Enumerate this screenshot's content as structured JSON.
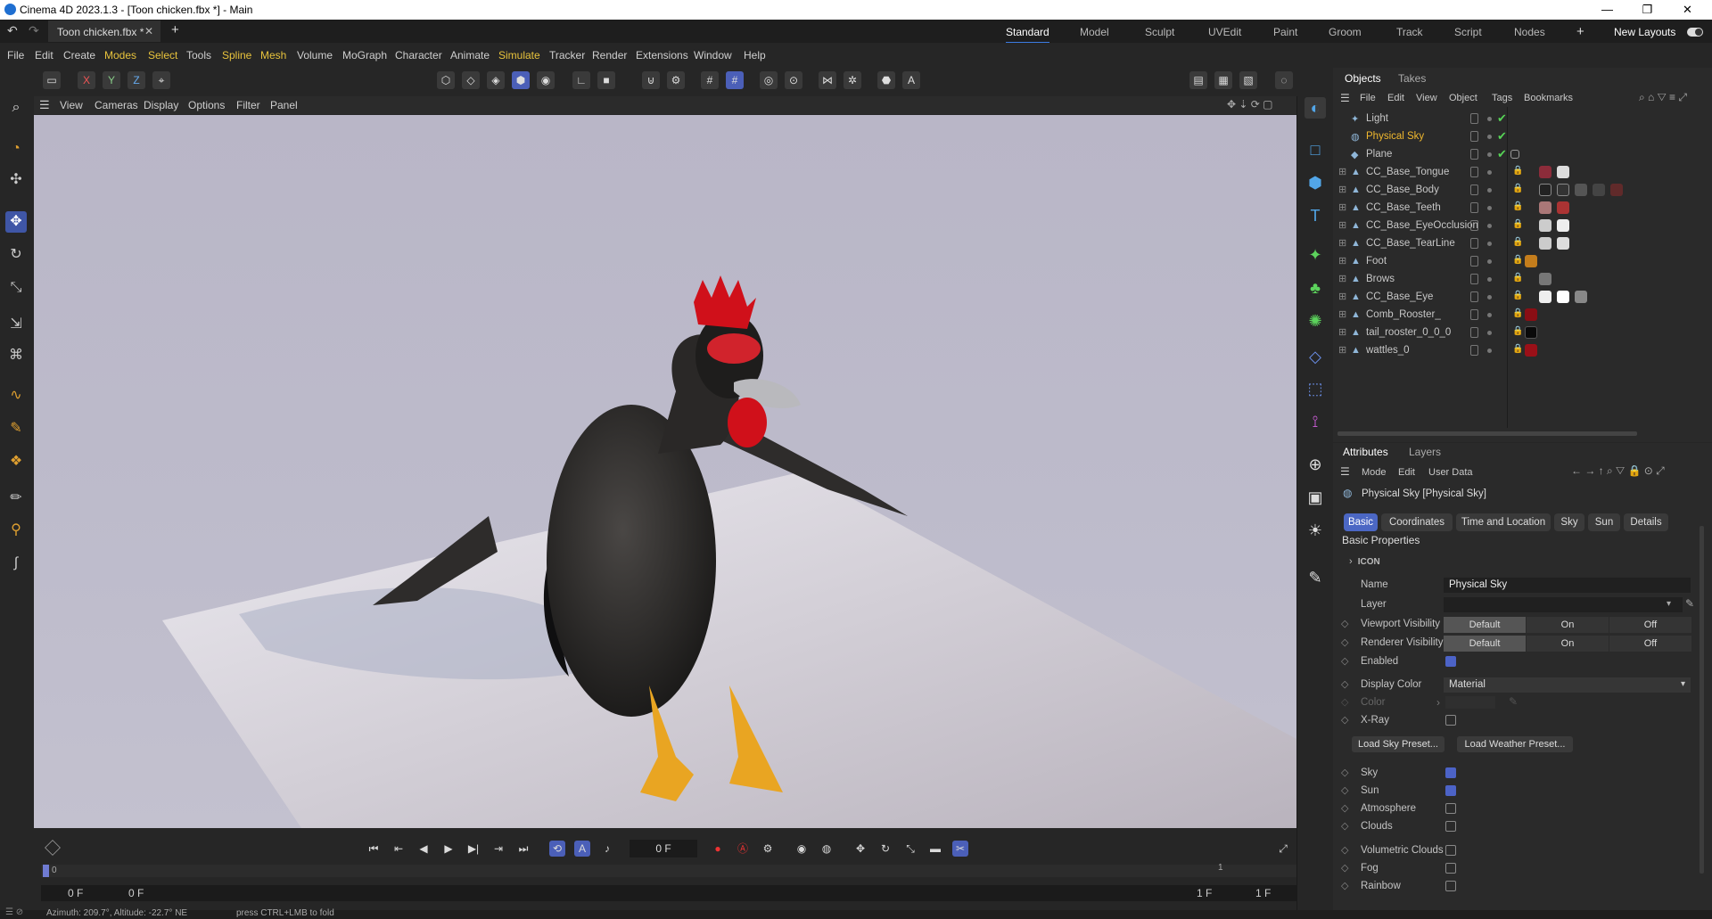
{
  "window": {
    "title": "Cinema 4D 2023.1.3 - [Toon chicken.fbx *] - Main",
    "minimize": "—",
    "maximize": "❐",
    "close": "✕"
  },
  "tabs": {
    "doc_tab": "Toon chicken.fbx *",
    "new_tab": "+",
    "layouts": [
      "Standard",
      "Model",
      "Sculpt",
      "UVEdit",
      "Paint",
      "Groom",
      "Track",
      "Script",
      "Nodes"
    ],
    "add_layout": "+",
    "new_layouts": "New Layouts"
  },
  "menu": [
    "File",
    "Edit",
    "Create",
    "Modes",
    "Select",
    "Tools",
    "Spline",
    "Mesh",
    "Volume",
    "MoGraph",
    "Character",
    "Animate",
    "Simulate",
    "Tracker",
    "Render",
    "Extensions",
    "Window",
    "Help"
  ],
  "toolbar": {
    "axis_x": "X",
    "axis_y": "Y",
    "axis_z": "Z"
  },
  "viewport_menu": [
    "View",
    "Cameras",
    "Display",
    "Options",
    "Filter",
    "Panel"
  ],
  "objects_panel": {
    "tabs": [
      "Objects",
      "Takes"
    ],
    "menu": [
      "File",
      "Edit",
      "View",
      "Object",
      "Tags",
      "Bookmarks"
    ],
    "items": [
      {
        "name": "Light"
      },
      {
        "name": "Physical Sky"
      },
      {
        "name": "Plane"
      },
      {
        "name": "CC_Base_Tongue"
      },
      {
        "name": "CC_Base_Body"
      },
      {
        "name": "CC_Base_Teeth"
      },
      {
        "name": "CC_Base_EyeOcclusion"
      },
      {
        "name": "CC_Base_TearLine"
      },
      {
        "name": "Foot"
      },
      {
        "name": "Brows"
      },
      {
        "name": "CC_Base_Eye"
      },
      {
        "name": "Comb_Rooster_"
      },
      {
        "name": "tail_rooster_0_0_0"
      },
      {
        "name": "wattles_0"
      }
    ]
  },
  "attributes": {
    "tabs": [
      "Attributes",
      "Layers"
    ],
    "menu": [
      "Mode",
      "Edit",
      "User Data"
    ],
    "object_title": "Physical Sky [Physical Sky]",
    "sub_tabs": [
      "Basic",
      "Coordinates",
      "Time and Location",
      "Sky",
      "Sun",
      "Details"
    ],
    "section": "Basic Properties",
    "icon_group": "ICON",
    "name_label": "Name",
    "name_value": "Physical Sky",
    "layer_label": "Layer",
    "viewport_vis_label": "Viewport Visibility",
    "renderer_vis_label": "Renderer Visibility",
    "vis_options": [
      "Default",
      "On",
      "Off"
    ],
    "enabled_label": "Enabled",
    "display_color_label": "Display Color",
    "display_color_value": "Material",
    "color_label": "Color",
    "xray_label": "X-Ray",
    "load_sky_preset": "Load Sky Preset...",
    "load_weather_preset": "Load Weather Preset...",
    "sky_label": "Sky",
    "sun_label": "Sun",
    "atmosphere_label": "Atmosphere",
    "clouds_label": "Clouds",
    "volumetric_clouds_label": "Volumetric Clouds",
    "fog_label": "Fog",
    "rainbow_label": "Rainbow"
  },
  "timeline": {
    "current_frame": "0 F",
    "start_frame": "0 F",
    "start_frame_2": "0 F",
    "ruler_0": "0",
    "ruler_1": "1",
    "end_frame": "1 F",
    "end_frame_2": "1 F"
  },
  "status": {
    "text": "Azimuth: 209.7°, Altitude: -22.7° NE",
    "hint": "press CTRL+LMB to fold"
  },
  "colors": {
    "accent_blue": "#4b5fb8",
    "highlight_orange": "#f0b82e",
    "check_green": "#56d356"
  }
}
